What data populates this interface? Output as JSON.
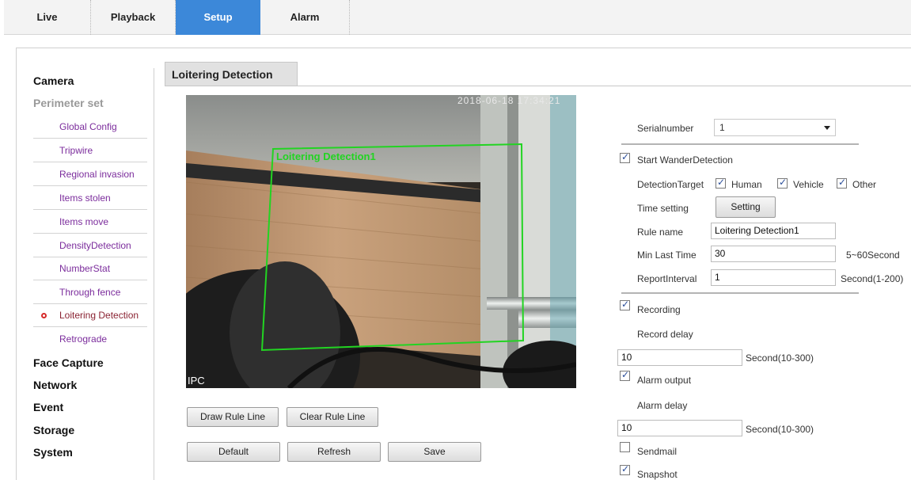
{
  "nav": {
    "tabs": [
      {
        "label": "Live"
      },
      {
        "label": "Playback"
      },
      {
        "label": "Setup"
      },
      {
        "label": "Alarm"
      }
    ],
    "active": "Setup"
  },
  "sidebar": {
    "camera": "Camera",
    "perimeter": "Perimeter set",
    "items": [
      {
        "label": "Global Config"
      },
      {
        "label": "Tripwire"
      },
      {
        "label": "Regional invasion"
      },
      {
        "label": "Items stolen"
      },
      {
        "label": "Items move"
      },
      {
        "label": "DensityDetection"
      },
      {
        "label": "NumberStat"
      },
      {
        "label": "Through fence"
      },
      {
        "label": "Loitering Detection"
      },
      {
        "label": "Retrograde"
      }
    ],
    "active_item": "Loitering Detection",
    "face_capture": "Face Capture",
    "network": "Network",
    "event": "Event",
    "storage": "Storage",
    "system": "System"
  },
  "section": {
    "title": "Loitering Detection"
  },
  "video": {
    "timestamp": "2018-06-18 17:34:21",
    "region_label": "Loitering Detection1",
    "ipc_label": "IPC",
    "region_color": "#22d422"
  },
  "buttons": {
    "draw_rule_line": "Draw Rule Line",
    "clear_rule_line": "Clear Rule Line",
    "default": "Default",
    "refresh": "Refresh",
    "save": "Save"
  },
  "settings": {
    "serial_label": "Serialnumber",
    "serial_value": "1",
    "start_wander": {
      "label": "Start WanderDetection",
      "checked": true
    },
    "detection_target_label": "DetectionTarget",
    "targets": [
      {
        "label": "Human",
        "checked": true
      },
      {
        "label": "Vehicle",
        "checked": true
      },
      {
        "label": "Other",
        "checked": true
      }
    ],
    "time_setting_label": "Time setting",
    "setting_button": "Setting",
    "rule_name_label": "Rule name",
    "rule_name_value": "Loitering Detection1",
    "min_last_time_label": "Min Last Time",
    "min_last_time_value": "30",
    "min_last_time_unit": "5~60Second",
    "report_interval_label": "ReportInterval",
    "report_interval_value": "1",
    "report_interval_unit": "Second(1-200)",
    "recording": {
      "label": "Recording",
      "checked": true
    },
    "record_delay_label": "Record delay",
    "record_delay_value": "10",
    "record_delay_unit": "Second(10-300)",
    "alarm_output": {
      "label": "Alarm output",
      "checked": true
    },
    "alarm_delay_label": "Alarm delay",
    "alarm_delay_value": "10",
    "alarm_delay_unit": "Second(10-300)",
    "sendmail": {
      "label": "Sendmail",
      "checked": false
    },
    "snapshot": {
      "label": "Snapshot",
      "checked": true
    }
  }
}
